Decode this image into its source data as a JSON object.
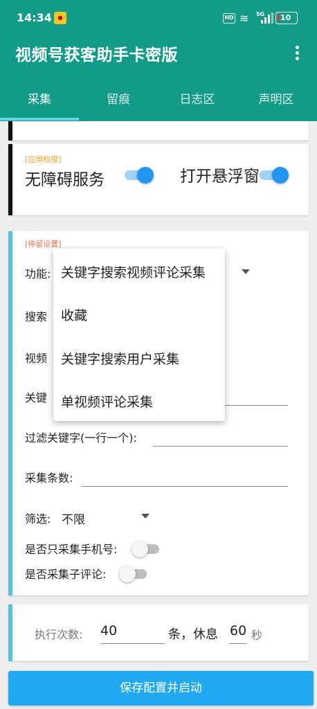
{
  "status_bar": {
    "time": "14:34",
    "hd": "HD",
    "network": "5G",
    "battery": "10"
  },
  "app": {
    "title": "视频号获客助手卡密版"
  },
  "tabs": [
    {
      "label": "采集",
      "active": true
    },
    {
      "label": "留痕",
      "active": false
    },
    {
      "label": "日志区",
      "active": false
    },
    {
      "label": "声明区",
      "active": false
    }
  ],
  "permissions": {
    "section_label": "[应用权限]",
    "accessibility_label": "无障碍服务",
    "accessibility_on": true,
    "overlay_label": "打开悬浮窗",
    "overlay_on": true
  },
  "stay_settings": {
    "section_label": "[停留设置]",
    "function_label": "功能:",
    "search_prefix": "搜索",
    "video_prefix": "视频",
    "keyword_prefix": "关键",
    "filter_keyword_label": "过滤关键字(一行一个):",
    "filter_keyword_value": "",
    "collect_count_label": "采集条数:",
    "collect_count_value": "",
    "filter_label": "筛选:",
    "filter_value": "不限",
    "only_phone_label": "是否只采集手机号:",
    "only_phone_on": false,
    "sub_comment_label": "是否采集子评论:",
    "sub_comment_on": false
  },
  "function_dropdown": {
    "options": [
      "关键字搜索视频评论采集",
      "收藏",
      "关键字搜索用户采集",
      "单视频评论采集"
    ]
  },
  "execution": {
    "times_label": "执行次数:",
    "times_value": "40",
    "unit_label": "条，休息",
    "rest_value": "60",
    "rest_unit": "秒"
  },
  "save_button": "保存配置并启动",
  "colors": {
    "app_bar": "#129c87",
    "tab_indicator": "#5fd4e6",
    "accent_blue": "#2196f3",
    "section_orange": "#f0a020",
    "section_red": "#e8734a",
    "card_bar_light_blue": "#55c2e0",
    "save_button": "#20a9f0"
  }
}
